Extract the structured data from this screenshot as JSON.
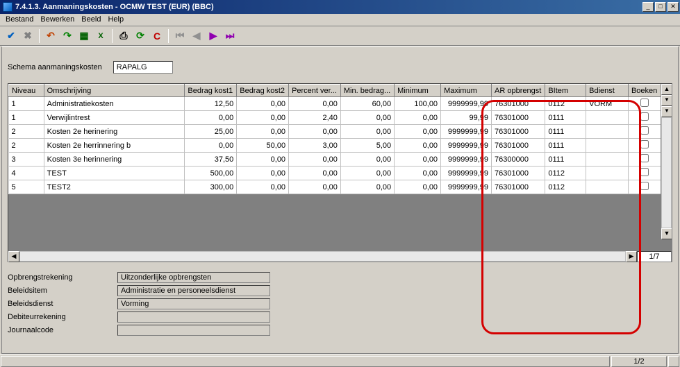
{
  "window": {
    "title": "7.4.1.3. Aanmaningskosten - OCMW TEST (EUR) (BBC)"
  },
  "menu": {
    "bestand": "Bestand",
    "bewerken": "Bewerken",
    "beeld": "Beeld",
    "help": "Help"
  },
  "schema": {
    "label": "Schema aanmaningskosten",
    "value": "RAPALG"
  },
  "grid": {
    "headers": {
      "niveau": "Niveau",
      "omschrijving": "Omschrijving",
      "bedrag1": "Bedrag kost1",
      "bedrag2": "Bedrag kost2",
      "percent": "Percent ver...",
      "minbedrag": "Min. bedrag...",
      "minimum": "Minimum",
      "maximum": "Maximum",
      "aropbrengst": "AR opbrengst",
      "bitem": "BItem",
      "bdienst": "Bdienst",
      "boeken": "Boeken"
    },
    "rows": [
      {
        "niveau": "1",
        "omschrijving": "Administratiekosten",
        "b1": "12,50",
        "b2": "0,00",
        "pct": "0,00",
        "minb": "60,00",
        "min": "100,00",
        "max": "9999999,99",
        "ar": "76301000",
        "bitem": "0112",
        "bdienst": "VORM",
        "boeken": false
      },
      {
        "niveau": "1",
        "omschrijving": "Verwijlintrest",
        "b1": "0,00",
        "b2": "0,00",
        "pct": "2,40",
        "minb": "0,00",
        "min": "0,00",
        "max": "99,99",
        "ar": "76301000",
        "bitem": "0111",
        "bdienst": "",
        "boeken": false
      },
      {
        "niveau": "2",
        "omschrijving": "Kosten 2e herinering",
        "b1": "25,00",
        "b2": "0,00",
        "pct": "0,00",
        "minb": "0,00",
        "min": "0,00",
        "max": "9999999,99",
        "ar": "76301000",
        "bitem": "0111",
        "bdienst": "",
        "boeken": false
      },
      {
        "niveau": "2",
        "omschrijving": "Kosten 2e herrinnering b",
        "b1": "0,00",
        "b2": "50,00",
        "pct": "3,00",
        "minb": "5,00",
        "min": "0,00",
        "max": "9999999,99",
        "ar": "76301000",
        "bitem": "0111",
        "bdienst": "",
        "boeken": false
      },
      {
        "niveau": "3",
        "omschrijving": "Kosten 3e herinnering",
        "b1": "37,50",
        "b2": "0,00",
        "pct": "0,00",
        "minb": "0,00",
        "min": "0,00",
        "max": "9999999,99",
        "ar": "76300000",
        "bitem": "0111",
        "bdienst": "",
        "boeken": false
      },
      {
        "niveau": "4",
        "omschrijving": "TEST",
        "b1": "500,00",
        "b2": "0,00",
        "pct": "0,00",
        "minb": "0,00",
        "min": "0,00",
        "max": "9999999,99",
        "ar": "76301000",
        "bitem": "0112",
        "bdienst": "",
        "boeken": false
      },
      {
        "niveau": "5",
        "omschrijving": "TEST2",
        "b1": "300,00",
        "b2": "0,00",
        "pct": "0,00",
        "minb": "0,00",
        "min": "0,00",
        "max": "9999999,99",
        "ar": "76301000",
        "bitem": "0112",
        "bdienst": "",
        "boeken": false
      }
    ],
    "page_indicator": "1/7"
  },
  "details": {
    "opbrengstrekening_label": "Opbrengstrekening",
    "opbrengstrekening_value": "Uitzonderlijke opbrengsten",
    "beleidsitem_label": "Beleidsitem",
    "beleidsitem_value": "Administratie en personeelsdienst",
    "beleidsdienst_label": "Beleidsdienst",
    "beleidsdienst_value": "Vorming",
    "debiteurrekening_label": "Debiteurrekening",
    "debiteurrekening_value": "",
    "journaalcode_label": "Journaalcode",
    "journaalcode_value": ""
  },
  "statusbar": {
    "page": "1/2"
  }
}
